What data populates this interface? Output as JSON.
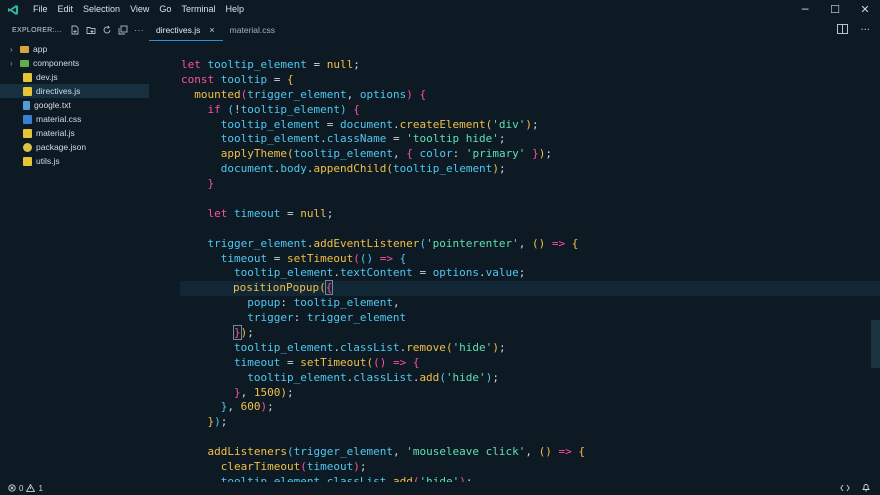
{
  "menu": [
    "File",
    "Edit",
    "Selection",
    "View",
    "Go",
    "Terminal",
    "Help"
  ],
  "window_controls": {
    "minimize": "─",
    "maximize": "☐",
    "close": "✕"
  },
  "explorer": {
    "title": "EXPLORER:...",
    "items": [
      {
        "label": "app",
        "type": "folder",
        "color": "#d8a53a"
      },
      {
        "label": "components",
        "type": "folder",
        "color": "#5fae4e"
      },
      {
        "label": "dev.js",
        "type": "js"
      },
      {
        "label": "directives.js",
        "type": "js",
        "active": true
      },
      {
        "label": "google.txt",
        "type": "txt"
      },
      {
        "label": "material.css",
        "type": "css"
      },
      {
        "label": "material.js",
        "type": "js"
      },
      {
        "label": "package.json",
        "type": "json"
      },
      {
        "label": "utils.js",
        "type": "js"
      }
    ]
  },
  "tabs": [
    {
      "label": "directives.js",
      "active": true,
      "close": "×"
    },
    {
      "label": "material.css",
      "active": false
    }
  ],
  "status": {
    "errors": "0",
    "warnings": "1"
  },
  "colors": {
    "background": "#0d1a24",
    "accent": "#2a8fd4",
    "keyword": "#ff4fa0",
    "variable": "#4fc8f0",
    "function": "#f0c048",
    "string": "#5fe0b2"
  }
}
